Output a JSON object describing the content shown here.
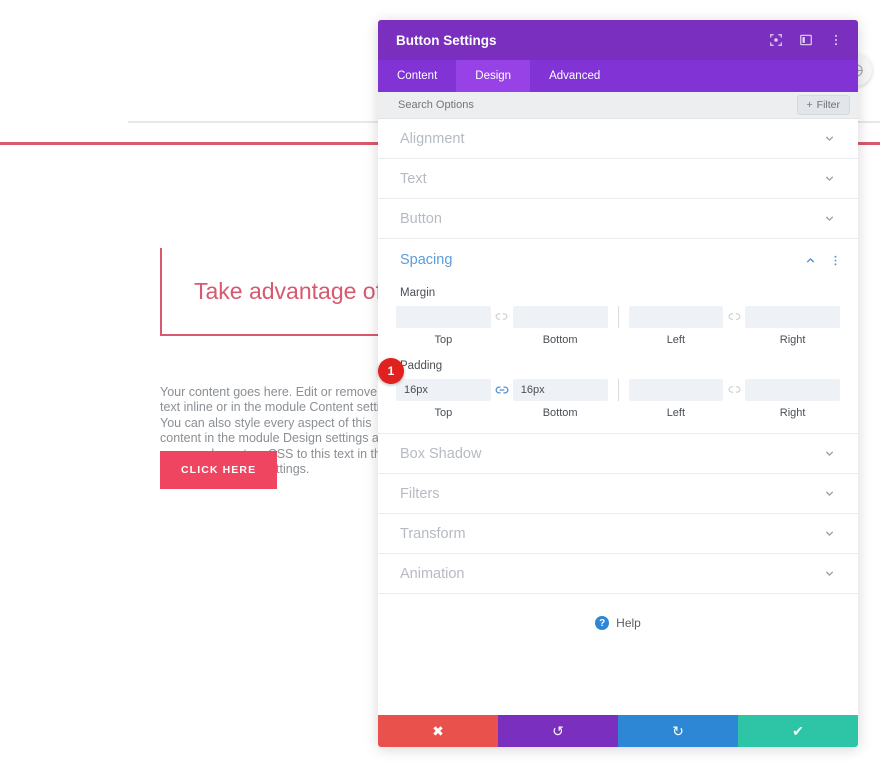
{
  "page": {
    "blurb_heading": "Take advantage of ou",
    "body_copy": "Your content goes here. Edit or remove this text inline or in the module Content settings. You can also style every aspect of this content in the module Design settings and even apply custom CSS to this text in the module Advanced settings.",
    "cta_label": "CLICK HERE",
    "globe_icon": "globe-icon",
    "accent_pink": "#d8596e",
    "cta_background": "#ef4560"
  },
  "panel": {
    "title": "Button Settings",
    "titlebar_icons": [
      {
        "name": "focus-icon"
      },
      {
        "name": "panel-layout-icon"
      },
      {
        "name": "more-options-icon"
      }
    ],
    "tabs": [
      {
        "label": "Content",
        "active": false
      },
      {
        "label": "Design",
        "active": true
      },
      {
        "label": "Advanced",
        "active": false
      }
    ],
    "search": {
      "placeholder": "Search Options",
      "value": "",
      "filter_label": "Filter",
      "filter_plus": "+"
    },
    "sections_top": [
      {
        "label": "Alignment"
      },
      {
        "label": "Text"
      },
      {
        "label": "Button"
      }
    ],
    "spacing": {
      "label": "Spacing",
      "expanded": true,
      "collapse_icon": "chevron-up-icon",
      "more_icon": "more-options-icon",
      "margin": {
        "label": "Margin",
        "fields": [
          {
            "caption": "Top",
            "value": "",
            "placeholder": ""
          },
          {
            "caption": "Bottom",
            "value": "",
            "placeholder": ""
          },
          {
            "caption": "Left",
            "value": "",
            "placeholder": ""
          },
          {
            "caption": "Right",
            "value": "",
            "placeholder": ""
          }
        ],
        "link_left": {
          "name": "unlink-icon",
          "state": "unlinked"
        },
        "link_right": {
          "name": "unlink-icon",
          "state": "unlinked"
        }
      },
      "padding": {
        "label": "Padding",
        "fields": [
          {
            "caption": "Top",
            "value": "16px",
            "placeholder": ""
          },
          {
            "caption": "Bottom",
            "value": "16px",
            "placeholder": ""
          },
          {
            "caption": "Left",
            "value": "",
            "placeholder": ""
          },
          {
            "caption": "Right",
            "value": "",
            "placeholder": ""
          }
        ],
        "link_left": {
          "name": "link-icon",
          "state": "linked"
        },
        "link_right": {
          "name": "unlink-icon",
          "state": "unlinked"
        }
      },
      "step_badge": "1"
    },
    "sections_bottom": [
      {
        "label": "Box Shadow"
      },
      {
        "label": "Filters"
      },
      {
        "label": "Transform"
      },
      {
        "label": "Animation"
      }
    ],
    "help": {
      "label": "Help",
      "icon": "question-mark-icon",
      "glyph": "?"
    },
    "footer": [
      {
        "name": "cancel-button",
        "icon": "close-icon",
        "glyph": "✖",
        "color": "#e8514c"
      },
      {
        "name": "undo-button",
        "icon": "undo-icon",
        "glyph": "↺",
        "color": "#7b2fbe"
      },
      {
        "name": "redo-button",
        "icon": "redo-icon",
        "glyph": "↻",
        "color": "#2e87d4"
      },
      {
        "name": "save-button",
        "icon": "check-icon",
        "glyph": "✔",
        "color": "#2ec4a6"
      }
    ]
  }
}
